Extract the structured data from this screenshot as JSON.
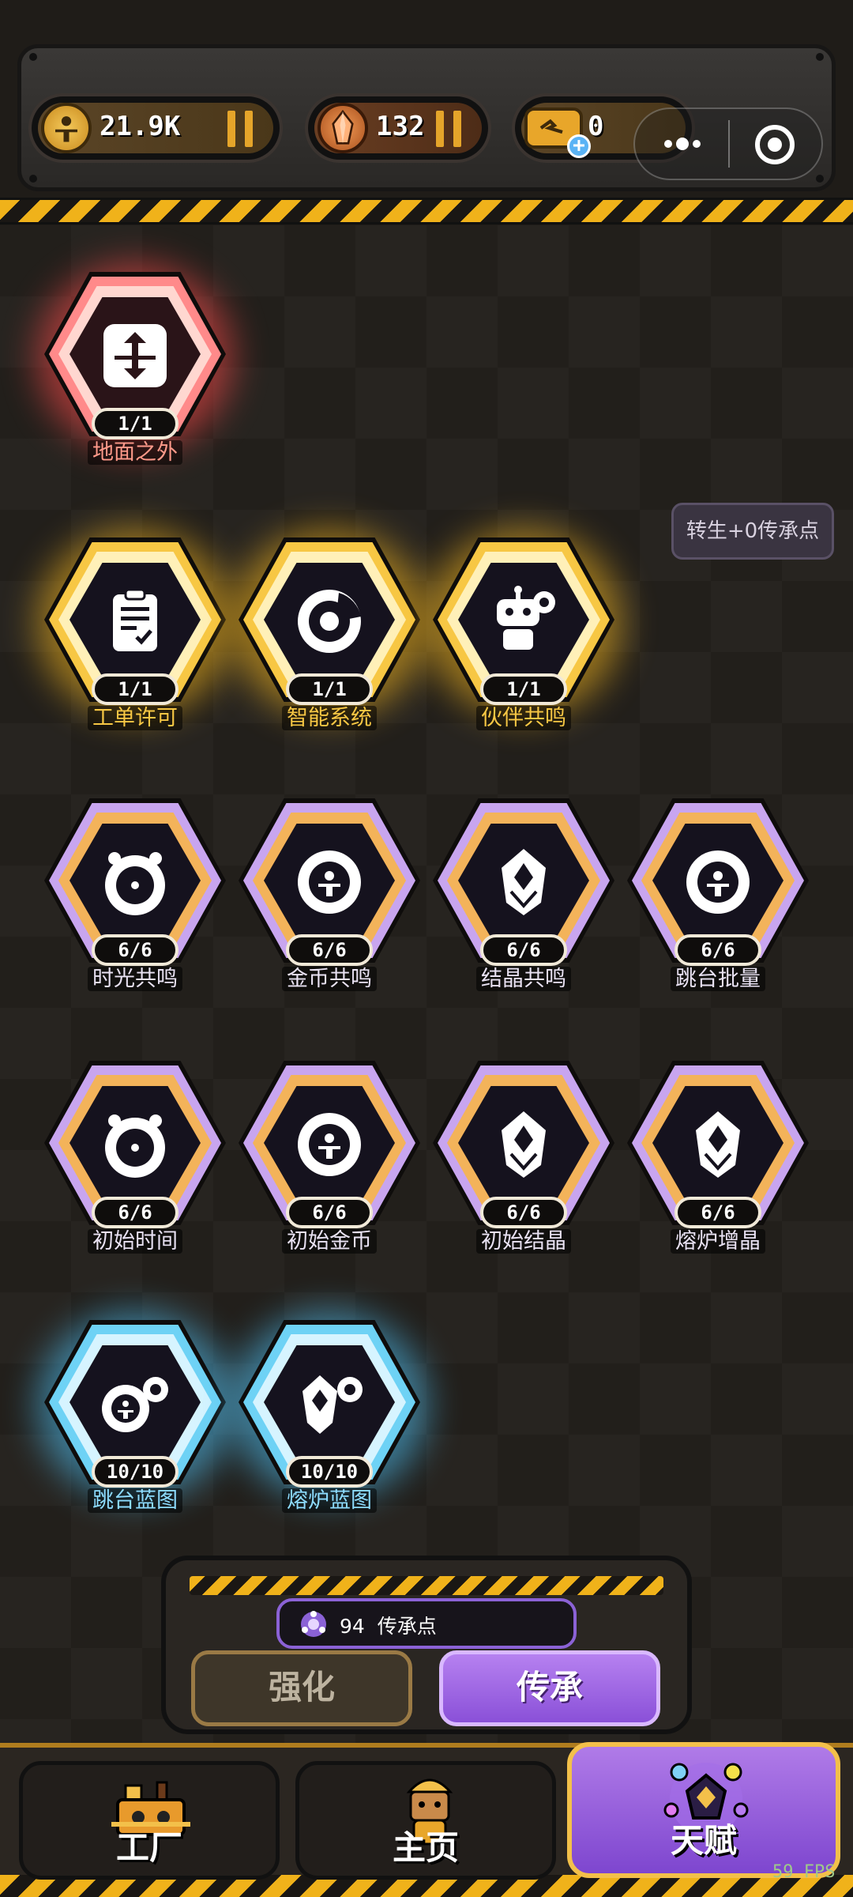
{
  "resources": {
    "coins": {
      "value": "21.9K",
      "icon": "coin-icon"
    },
    "crystals": {
      "value": "132",
      "icon": "crystal-icon"
    },
    "tickets": {
      "value": "0",
      "icon": "ticket-icon",
      "plus_icon": "plus-icon"
    }
  },
  "capsule": {
    "more_icon": "more-dots-icon",
    "close_icon": "target-circle-icon"
  },
  "rebirth_label": "转生+0传承点",
  "talents": [
    {
      "name": "地面之外",
      "level": "1/1",
      "tier": "red",
      "icon": "lift-arrows-icon"
    },
    {
      "name": "工单许可",
      "level": "1/1",
      "tier": "gold",
      "icon": "clipboard-icon"
    },
    {
      "name": "智能系统",
      "level": "1/1",
      "tier": "gold",
      "icon": "smart-ring-icon"
    },
    {
      "name": "伙伴共鸣",
      "level": "1/1",
      "tier": "gold",
      "icon": "robot-gear-icon"
    },
    {
      "name": "时光共鸣",
      "level": "6/6",
      "tier": "purple",
      "icon": "clock-eye-icon"
    },
    {
      "name": "金币共鸣",
      "level": "6/6",
      "tier": "purple",
      "icon": "coin-face-icon"
    },
    {
      "name": "结晶共鸣",
      "level": "6/6",
      "tier": "purple",
      "icon": "crystal-shield-icon"
    },
    {
      "name": "跳台批量",
      "level": "6/6",
      "tier": "purple",
      "icon": "coin-face-icon"
    },
    {
      "name": "初始时间",
      "level": "6/6",
      "tier": "purple",
      "icon": "clock-eye-icon"
    },
    {
      "name": "初始金币",
      "level": "6/6",
      "tier": "purple",
      "icon": "coin-face-icon"
    },
    {
      "name": "初始结晶",
      "level": "6/6",
      "tier": "purple",
      "icon": "crystal-shield-icon"
    },
    {
      "name": "熔炉增晶",
      "level": "6/6",
      "tier": "purple",
      "icon": "crystal-shield-icon"
    },
    {
      "name": "跳台蓝图",
      "level": "10/10",
      "tier": "blue",
      "icon": "coin-gear-icon"
    },
    {
      "name": "熔炉蓝图",
      "level": "10/10",
      "tier": "blue",
      "icon": "crystal-gear-icon"
    }
  ],
  "legacy_points": {
    "value": "94",
    "label": "传承点",
    "icon": "legacy-orb-icon"
  },
  "tabs": {
    "strengthen": "强化",
    "inherit": "传承",
    "active": "inherit"
  },
  "nav": {
    "factory": {
      "label": "工厂",
      "icon": "factory-robot-icon"
    },
    "home": {
      "label": "主页",
      "icon": "worker-avatar-icon"
    },
    "talent": {
      "label": "天赋",
      "icon": "talent-gem-icon",
      "active": true
    }
  },
  "fps": "59 FPS",
  "colors": {
    "red": "#ff6b6b",
    "gold": "#f7c744",
    "purple": "#c8a5ef",
    "blue": "#6ed2f5",
    "accent_purple": "#8b62d6",
    "hazard_yellow": "#f0b21a"
  }
}
